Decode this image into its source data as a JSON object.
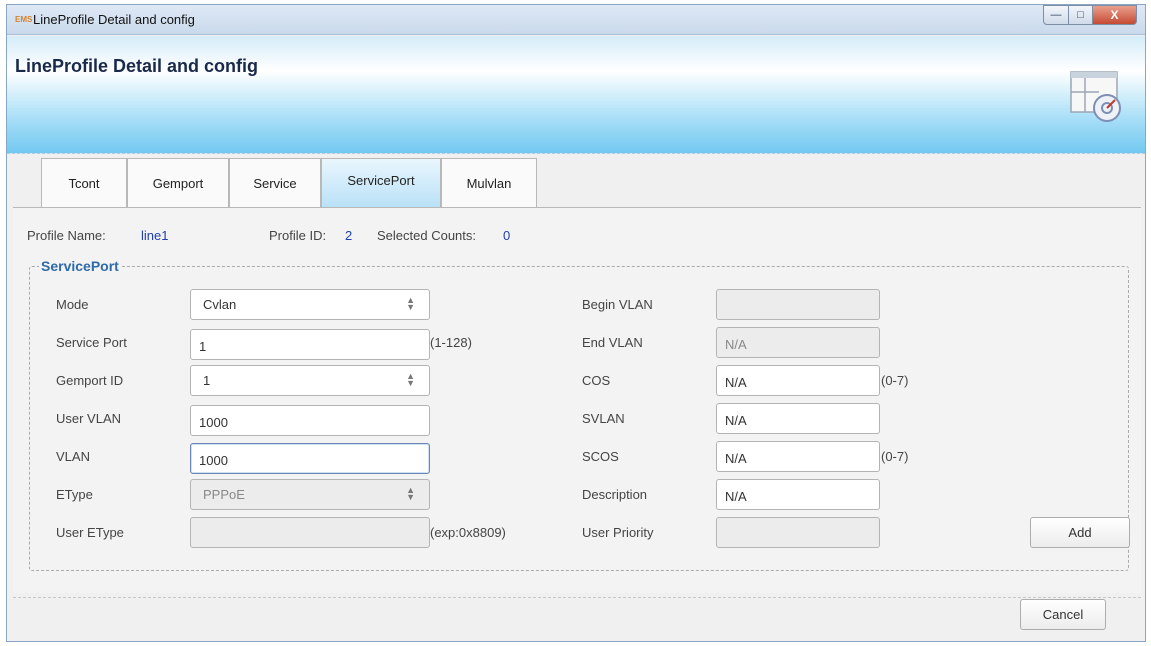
{
  "window": {
    "title": "LineProfile Detail and config",
    "app_icon": "app-icon",
    "minimize_glyph": "—",
    "maximize_glyph": "□",
    "close_glyph": "X"
  },
  "header": {
    "title": "LineProfile Detail and config"
  },
  "tabs": [
    {
      "label": "Tcont",
      "active": false
    },
    {
      "label": "Gemport",
      "active": false
    },
    {
      "label": "Service",
      "active": false
    },
    {
      "label": "ServicePort",
      "active": true
    },
    {
      "label": "Mulvlan",
      "active": false
    }
  ],
  "profile": {
    "name_label": "Profile Name:",
    "name_value": "line1",
    "id_label": "Profile ID:",
    "id_value": "2",
    "selected_label": "Selected Counts:",
    "selected_value": "0"
  },
  "group": {
    "legend": "ServicePort"
  },
  "form": {
    "mode": {
      "label": "Mode",
      "value": "Cvlan"
    },
    "service_port": {
      "label": "Service Port",
      "value": "1",
      "hint": "(1-128)"
    },
    "gemport_id": {
      "label": "Gemport ID",
      "value": "1"
    },
    "user_vlan": {
      "label": "User VLAN",
      "value": "1000"
    },
    "vlan": {
      "label": "VLAN",
      "value": "1000"
    },
    "etype": {
      "label": "EType",
      "value": "PPPoE"
    },
    "user_etype": {
      "label": "User EType",
      "value": "",
      "hint": "(exp:0x8809)"
    },
    "begin_vlan": {
      "label": "Begin VLAN",
      "value": ""
    },
    "end_vlan": {
      "label": "End VLAN",
      "value": "N/A"
    },
    "cos": {
      "label": "COS",
      "value": "N/A",
      "hint": "(0-7)"
    },
    "svlan": {
      "label": "SVLAN",
      "value": "N/A"
    },
    "scos": {
      "label": "SCOS",
      "value": "N/A",
      "hint": "(0-7)"
    },
    "description": {
      "label": "Description",
      "value": "N/A"
    },
    "user_priority": {
      "label": "User Priority",
      "value": ""
    }
  },
  "buttons": {
    "add": "Add",
    "cancel": "Cancel"
  },
  "colors": {
    "accent": "#2f6aa8",
    "value_text": "#1f3fb0",
    "banner": "#72c8f1"
  }
}
